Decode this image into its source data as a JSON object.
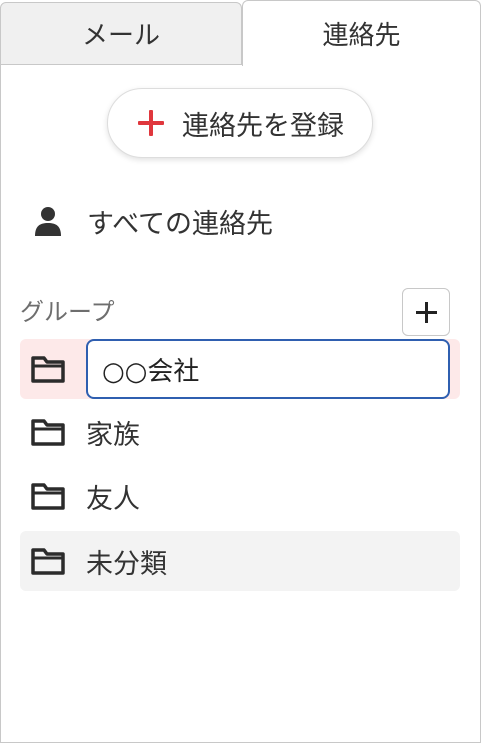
{
  "tabs": [
    {
      "label": "メール"
    },
    {
      "label": "連絡先"
    }
  ],
  "register_button": {
    "label": "連絡先を登録"
  },
  "all_contacts": {
    "label": "すべての連絡先"
  },
  "groups": {
    "header": "グループ",
    "editing_value": "○○会社",
    "items": [
      {
        "label": "家族"
      },
      {
        "label": "友人"
      },
      {
        "label": "未分類"
      }
    ]
  },
  "colors": {
    "accent_red": "#e0373d",
    "input_border": "#2f5fb0",
    "editing_row_bg": "#fde9e9",
    "selected_row_bg": "#f3f3f3"
  },
  "icons": [
    "plus-icon",
    "person-icon",
    "folder-icon"
  ]
}
